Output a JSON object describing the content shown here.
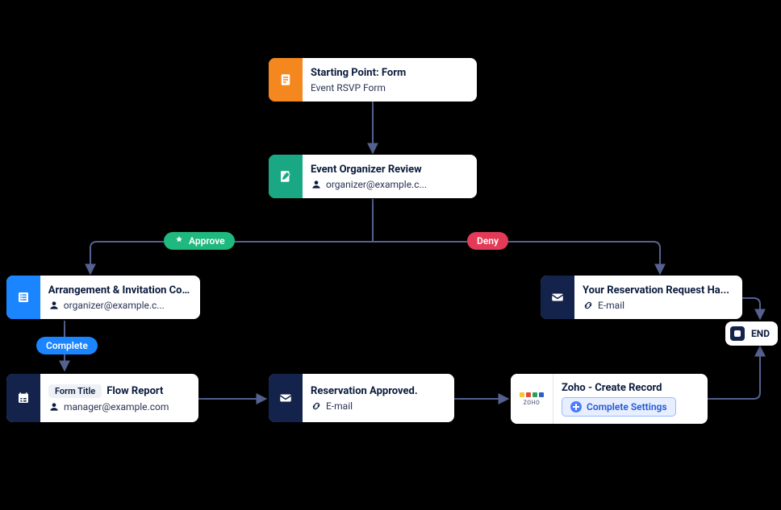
{
  "start": {
    "title": "Starting Point: Form",
    "subtitle": "Event RSVP Form"
  },
  "review": {
    "title": "Event Organizer Review",
    "subtitle": "organizer@example.c..."
  },
  "decision": {
    "approve_label": "Approve",
    "deny_label": "Deny"
  },
  "approve_branch": {
    "step1": {
      "title": "Arrangement & Invitation Co...",
      "subtitle": "organizer@example.c..."
    },
    "complete_label": "Complete",
    "step2": {
      "form_title_label": "Form Title",
      "form_title_value": "Flow Report",
      "subtitle": "manager@example.com"
    },
    "step3": {
      "title": "Reservation Approved.",
      "subtitle": "E-mail"
    },
    "step4": {
      "title": "Zoho - Create Record",
      "button_label": "Complete Settings",
      "zoho_brand": "ZOHO"
    }
  },
  "deny_branch": {
    "step1": {
      "title": "Your Reservation Request Ha...",
      "subtitle": "E-mail"
    }
  },
  "end": {
    "label": "END"
  }
}
